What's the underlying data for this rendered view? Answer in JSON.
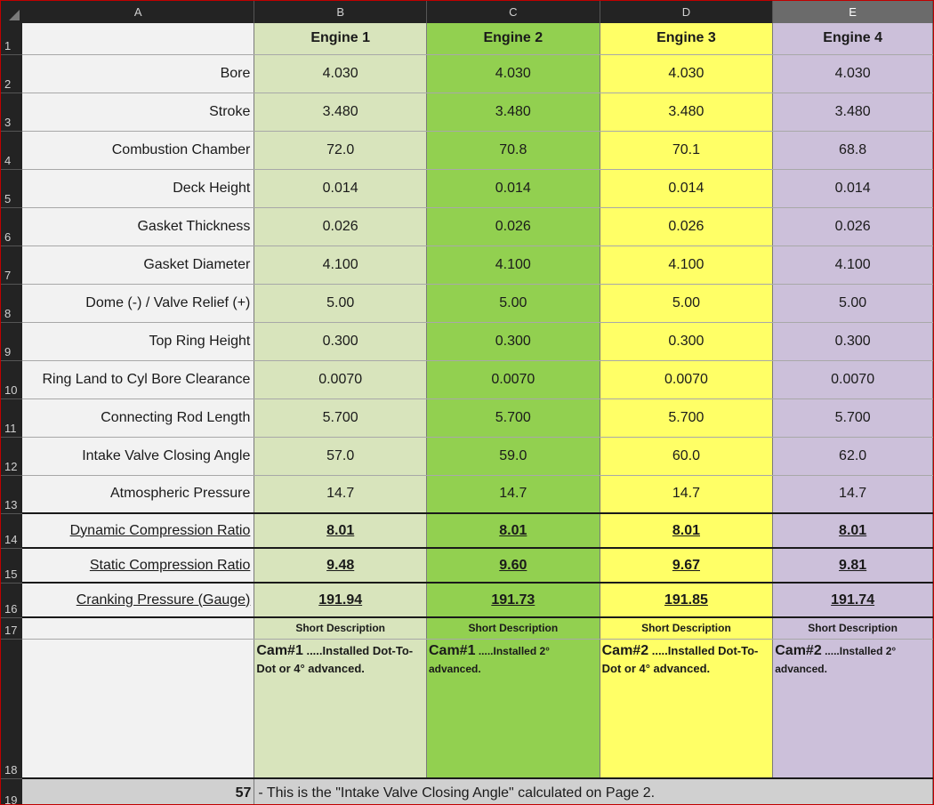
{
  "columns": [
    "A",
    "B",
    "C",
    "D",
    "E"
  ],
  "selected_column": "E",
  "rows": [
    "1",
    "2",
    "3",
    "4",
    "5",
    "6",
    "7",
    "8",
    "9",
    "10",
    "11",
    "12",
    "13",
    "14",
    "15",
    "16",
    "17",
    "18",
    "19"
  ],
  "headers": [
    "Engine 1",
    "Engine 2",
    "Engine 3",
    "Engine 4"
  ],
  "params": [
    {
      "label": "Bore",
      "values": [
        "4.030",
        "4.030",
        "4.030",
        "4.030"
      ]
    },
    {
      "label": "Stroke",
      "values": [
        "3.480",
        "3.480",
        "3.480",
        "3.480"
      ]
    },
    {
      "label": "Combustion Chamber",
      "values": [
        "72.0",
        "70.8",
        "70.1",
        "68.8"
      ]
    },
    {
      "label": "Deck Height",
      "values": [
        "0.014",
        "0.014",
        "0.014",
        "0.014"
      ]
    },
    {
      "label": "Gasket Thickness",
      "values": [
        "0.026",
        "0.026",
        "0.026",
        "0.026"
      ]
    },
    {
      "label": "Gasket Diameter",
      "values": [
        "4.100",
        "4.100",
        "4.100",
        "4.100"
      ]
    },
    {
      "label": "Dome (-) / Valve Relief (+)",
      "values": [
        "5.00",
        "5.00",
        "5.00",
        "5.00"
      ]
    },
    {
      "label": "Top Ring Height",
      "values": [
        "0.300",
        "0.300",
        "0.300",
        "0.300"
      ]
    },
    {
      "label": "Ring Land to Cyl Bore Clearance",
      "values": [
        "0.0070",
        "0.0070",
        "0.0070",
        "0.0070"
      ]
    },
    {
      "label": "Connecting Rod Length",
      "values": [
        "5.700",
        "5.700",
        "5.700",
        "5.700"
      ]
    },
    {
      "label": "Intake Valve Closing Angle",
      "values": [
        "57.0",
        "59.0",
        "60.0",
        "62.0"
      ]
    },
    {
      "label": "Atmospheric Pressure",
      "values": [
        "14.7",
        "14.7",
        "14.7",
        "14.7"
      ]
    }
  ],
  "results": [
    {
      "label": "Dynamic Compression Ratio",
      "values": [
        "8.01",
        "8.01",
        "8.01",
        "8.01"
      ]
    },
    {
      "label": "Static Compression Ratio",
      "values": [
        "9.48",
        "9.60",
        "9.67",
        "9.81"
      ]
    },
    {
      "label": "Cranking Pressure (Gauge)",
      "values": [
        "191.94",
        "191.73",
        "191.85",
        "191.74"
      ]
    }
  ],
  "short_description_label": "Short Description",
  "descriptions": [
    {
      "cam": "Cam#1",
      "text": " .....Installed Dot-To-Dot or 4° advanced."
    },
    {
      "cam": "Cam#1",
      "text": " .....Installed 2° advanced."
    },
    {
      "cam": "Cam#2",
      "text": " .....Installed Dot-To-Dot or 4° advanced."
    },
    {
      "cam": "Cam#2",
      "text": " .....Installed 2° advanced."
    }
  ],
  "footer": {
    "value": "57",
    "note": " - This is the \"Intake Valve Closing Angle\" calculated on Page 2."
  },
  "colors": {
    "engine1": "#d8e4bc",
    "engine2": "#92d050",
    "engine3": "#ffff66",
    "engine4": "#ccc0da",
    "label": "#f2f2f2",
    "header_bg": "#232323"
  }
}
